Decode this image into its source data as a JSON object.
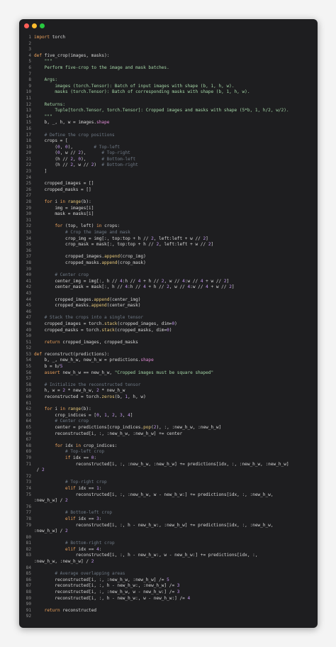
{
  "window": {
    "title_dots": [
      "close",
      "minimize",
      "zoom"
    ],
    "colors": {
      "background": "#1e1e20",
      "keyword": "#f0a45d",
      "string": "#a5d6a7",
      "comment": "#6f7a86",
      "number": "#c79bf2",
      "function": "#e8c97a",
      "attribute": "#e08bd6"
    }
  },
  "lines": [
    {
      "n": "1",
      "t": [
        [
          "kw",
          "import"
        ],
        [
          "p",
          " torch"
        ]
      ]
    },
    {
      "n": "2",
      "t": []
    },
    {
      "n": "3",
      "t": []
    },
    {
      "n": "4",
      "t": [
        [
          "kw",
          "def"
        ],
        [
          "p",
          " five_crop(images, masks):"
        ]
      ]
    },
    {
      "n": "5",
      "t": [
        [
          "str",
          "    \"\"\""
        ]
      ]
    },
    {
      "n": "6",
      "t": [
        [
          "str",
          "    Perform five-crop to the image and mask batches."
        ]
      ]
    },
    {
      "n": "7",
      "t": []
    },
    {
      "n": "8",
      "t": [
        [
          "str",
          "    Args:"
        ]
      ]
    },
    {
      "n": "9",
      "t": [
        [
          "str",
          "        images (torch.Tensor): Batch of input images with shape (b, 1, h, w)."
        ]
      ]
    },
    {
      "n": "10",
      "t": [
        [
          "str",
          "        masks (torch.Tensor): Batch of corresponding masks with shape (b, 1, h, w)."
        ]
      ]
    },
    {
      "n": "11",
      "t": []
    },
    {
      "n": "12",
      "t": [
        [
          "str",
          "    Returns:"
        ]
      ]
    },
    {
      "n": "13",
      "t": [
        [
          "str",
          "        Tuple[torch.Tensor, torch.Tensor]: Cropped images and masks with shape (5*b, 1, h/2, w/2)."
        ]
      ]
    },
    {
      "n": "14",
      "t": [
        [
          "str",
          "    \"\"\""
        ]
      ]
    },
    {
      "n": "15",
      "t": [
        [
          "p",
          "    b, _, h, w = images."
        ],
        [
          "attr",
          "shape"
        ]
      ]
    },
    {
      "n": "16",
      "t": []
    },
    {
      "n": "17",
      "t": [
        [
          "com",
          "    # Define the crop positions"
        ]
      ]
    },
    {
      "n": "18",
      "t": [
        [
          "p",
          "    crops = ["
        ]
      ]
    },
    {
      "n": "19",
      "t": [
        [
          "p",
          "        ("
        ],
        [
          "num",
          "0"
        ],
        [
          "p",
          ", "
        ],
        [
          "num",
          "0"
        ],
        [
          "p",
          "),        "
        ],
        [
          "com",
          "# Top-left"
        ]
      ]
    },
    {
      "n": "20",
      "t": [
        [
          "p",
          "        ("
        ],
        [
          "num",
          "0"
        ],
        [
          "p",
          ", w // "
        ],
        [
          "num",
          "2"
        ],
        [
          "p",
          "),      "
        ],
        [
          "com",
          "# Top-right"
        ]
      ]
    },
    {
      "n": "21",
      "t": [
        [
          "p",
          "        (h // "
        ],
        [
          "num",
          "2"
        ],
        [
          "p",
          ", "
        ],
        [
          "num",
          "0"
        ],
        [
          "p",
          "),      "
        ],
        [
          "com",
          "# Bottom-left"
        ]
      ]
    },
    {
      "n": "22",
      "t": [
        [
          "p",
          "        (h // "
        ],
        [
          "num",
          "2"
        ],
        [
          "p",
          ", w // "
        ],
        [
          "num",
          "2"
        ],
        [
          "p",
          ")  "
        ],
        [
          "com",
          "# Bottom-right"
        ]
      ]
    },
    {
      "n": "23",
      "t": [
        [
          "p",
          "    ]"
        ]
      ]
    },
    {
      "n": "24",
      "t": []
    },
    {
      "n": "25",
      "t": [
        [
          "p",
          "    cropped_images = []"
        ]
      ]
    },
    {
      "n": "26",
      "t": [
        [
          "p",
          "    cropped_masks = []"
        ]
      ]
    },
    {
      "n": "27",
      "t": []
    },
    {
      "n": "28",
      "t": [
        [
          "kw",
          "    for"
        ],
        [
          "p",
          " i "
        ],
        [
          "kw",
          "in"
        ],
        [
          "p",
          " "
        ],
        [
          "fn",
          "range"
        ],
        [
          "p",
          "(b):"
        ]
      ]
    },
    {
      "n": "29",
      "t": [
        [
          "p",
          "        img = images[i]"
        ]
      ]
    },
    {
      "n": "30",
      "t": [
        [
          "p",
          "        mask = masks[i]"
        ]
      ]
    },
    {
      "n": "31",
      "t": []
    },
    {
      "n": "32",
      "t": [
        [
          "kw",
          "        for"
        ],
        [
          "p",
          " (top, left) "
        ],
        [
          "kw",
          "in"
        ],
        [
          "p",
          " crops:"
        ]
      ]
    },
    {
      "n": "33",
      "t": [
        [
          "com",
          "            # Crop the image and mask"
        ]
      ]
    },
    {
      "n": "34",
      "t": [
        [
          "p",
          "            crop_img = img[:, top:top + h // "
        ],
        [
          "num",
          "2"
        ],
        [
          "p",
          ", left:left + w // "
        ],
        [
          "num",
          "2"
        ],
        [
          "p",
          "]"
        ]
      ]
    },
    {
      "n": "35",
      "t": [
        [
          "p",
          "            crop_mask = mask[:, top:top + h // "
        ],
        [
          "num",
          "2"
        ],
        [
          "p",
          ", left:left + w // "
        ],
        [
          "num",
          "2"
        ],
        [
          "p",
          "]"
        ]
      ]
    },
    {
      "n": "36",
      "t": []
    },
    {
      "n": "37",
      "t": [
        [
          "p",
          "            cropped_images."
        ],
        [
          "fn",
          "append"
        ],
        [
          "p",
          "(crop_img)"
        ]
      ]
    },
    {
      "n": "38",
      "t": [
        [
          "p",
          "            cropped_masks."
        ],
        [
          "fn",
          "append"
        ],
        [
          "p",
          "(crop_mask)"
        ]
      ]
    },
    {
      "n": "39",
      "t": []
    },
    {
      "n": "40",
      "t": [
        [
          "com",
          "        # Center crop"
        ]
      ]
    },
    {
      "n": "41",
      "t": [
        [
          "p",
          "        center_img = img[:, h // "
        ],
        [
          "num",
          "4"
        ],
        [
          "p",
          ":h // "
        ],
        [
          "num",
          "4"
        ],
        [
          "p",
          " + h // "
        ],
        [
          "num",
          "2"
        ],
        [
          "p",
          ", w // "
        ],
        [
          "num",
          "4"
        ],
        [
          "p",
          ":w // "
        ],
        [
          "num",
          "4"
        ],
        [
          "p",
          " + w // "
        ],
        [
          "num",
          "2"
        ],
        [
          "p",
          "]"
        ]
      ]
    },
    {
      "n": "42",
      "t": [
        [
          "p",
          "        center_mask = mask[:, h // "
        ],
        [
          "num",
          "4"
        ],
        [
          "p",
          ":h // "
        ],
        [
          "num",
          "4"
        ],
        [
          "p",
          " + h // "
        ],
        [
          "num",
          "2"
        ],
        [
          "p",
          ", w // "
        ],
        [
          "num",
          "4"
        ],
        [
          "p",
          ":w // "
        ],
        [
          "num",
          "4"
        ],
        [
          "p",
          " + w // "
        ],
        [
          "num",
          "2"
        ],
        [
          "p",
          "]"
        ]
      ]
    },
    {
      "n": "43",
      "t": []
    },
    {
      "n": "44",
      "t": [
        [
          "p",
          "        cropped_images."
        ],
        [
          "fn",
          "append"
        ],
        [
          "p",
          "(center_img)"
        ]
      ]
    },
    {
      "n": "45",
      "t": [
        [
          "p",
          "        cropped_masks."
        ],
        [
          "fn",
          "append"
        ],
        [
          "p",
          "(center_mask)"
        ]
      ]
    },
    {
      "n": "46",
      "t": []
    },
    {
      "n": "47",
      "t": [
        [
          "com",
          "    # Stack the crops into a single tensor"
        ]
      ]
    },
    {
      "n": "48",
      "t": [
        [
          "p",
          "    cropped_images = torch."
        ],
        [
          "fn",
          "stack"
        ],
        [
          "p",
          "(cropped_images, dim="
        ],
        [
          "num",
          "0"
        ],
        [
          "p",
          ")"
        ]
      ]
    },
    {
      "n": "49",
      "t": [
        [
          "p",
          "    cropped_masks = torch."
        ],
        [
          "fn",
          "stack"
        ],
        [
          "p",
          "(cropped_masks, dim="
        ],
        [
          "num",
          "0"
        ],
        [
          "p",
          ")"
        ]
      ]
    },
    {
      "n": "50",
      "t": []
    },
    {
      "n": "51",
      "t": [
        [
          "kw",
          "    return"
        ],
        [
          "p",
          " cropped_images, cropped_masks"
        ]
      ]
    },
    {
      "n": "52",
      "t": []
    },
    {
      "n": "53",
      "t": [
        [
          "kw",
          "def"
        ],
        [
          "p",
          " reconstruct(predictions):"
        ]
      ]
    },
    {
      "n": "54",
      "t": [
        [
          "p",
          "    b, _, new_h_w, new_h_w = predictions."
        ],
        [
          "attr",
          "shape"
        ]
      ]
    },
    {
      "n": "55",
      "t": [
        [
          "p",
          "    b = b/"
        ],
        [
          "num",
          "5"
        ]
      ]
    },
    {
      "n": "56",
      "t": [
        [
          "kw",
          "    assert"
        ],
        [
          "p",
          " new_h_w == new_h_w, "
        ],
        [
          "str",
          "\"Cropped images must be square shaped\""
        ]
      ]
    },
    {
      "n": "57",
      "t": []
    },
    {
      "n": "58",
      "t": [
        [
          "com",
          "    # Initialize the reconstructed tensor"
        ]
      ]
    },
    {
      "n": "59",
      "t": [
        [
          "p",
          "    h, w = "
        ],
        [
          "num",
          "2"
        ],
        [
          "p",
          " * new_h_w, "
        ],
        [
          "num",
          "2"
        ],
        [
          "p",
          " * new_h_w"
        ]
      ]
    },
    {
      "n": "60",
      "t": [
        [
          "p",
          "    reconstructed = torch."
        ],
        [
          "fn",
          "zeros"
        ],
        [
          "p",
          "(b, "
        ],
        [
          "num",
          "1"
        ],
        [
          "p",
          ", h, w)"
        ]
      ]
    },
    {
      "n": "61",
      "t": []
    },
    {
      "n": "62",
      "t": [
        [
          "kw",
          "    for"
        ],
        [
          "p",
          " i "
        ],
        [
          "kw",
          "in"
        ],
        [
          "p",
          " "
        ],
        [
          "fn",
          "range"
        ],
        [
          "p",
          "(b):"
        ]
      ]
    },
    {
      "n": "63",
      "t": [
        [
          "p",
          "        crop_indices = ["
        ],
        [
          "num",
          "0"
        ],
        [
          "p",
          ", "
        ],
        [
          "num",
          "1"
        ],
        [
          "p",
          ", "
        ],
        [
          "num",
          "2"
        ],
        [
          "p",
          ", "
        ],
        [
          "num",
          "3"
        ],
        [
          "p",
          ", "
        ],
        [
          "num",
          "4"
        ],
        [
          "p",
          "]"
        ]
      ]
    },
    {
      "n": "64",
      "t": [
        [
          "com",
          "        # Center crop"
        ]
      ]
    },
    {
      "n": "65",
      "t": [
        [
          "p",
          "        center = predictions[crop_indices."
        ],
        [
          "fn",
          "pop"
        ],
        [
          "p",
          "("
        ],
        [
          "num",
          "2"
        ],
        [
          "p",
          "), :, :new_h_w, :new_h_w]"
        ]
      ]
    },
    {
      "n": "66",
      "t": [
        [
          "p",
          "        reconstructed[i, :, :new_h_w, :new_h_w] += center"
        ]
      ]
    },
    {
      "n": "67",
      "t": []
    },
    {
      "n": "68",
      "t": [
        [
          "kw",
          "        for"
        ],
        [
          "p",
          " idx "
        ],
        [
          "kw",
          "in"
        ],
        [
          "p",
          " crop_indices:"
        ]
      ]
    },
    {
      "n": "69",
      "t": [
        [
          "com",
          "            # Top-left crop"
        ]
      ]
    },
    {
      "n": "70",
      "t": [
        [
          "kw",
          "            if"
        ],
        [
          "p",
          " idx == "
        ],
        [
          "num",
          "0"
        ],
        [
          "p",
          ":"
        ]
      ]
    },
    {
      "n": "71",
      "t": [
        [
          "p",
          "                reconstructed[i, :, :new_h_w, :new_h_w] += predictions[idx, :, :new_h_w, :new_h_w]"
        ]
      ]
    },
    {
      "n": "",
      "t": [
        [
          "p",
          " / "
        ],
        [
          "num",
          "2"
        ]
      ]
    },
    {
      "n": "72",
      "t": []
    },
    {
      "n": "73",
      "t": [
        [
          "com",
          "            # Top-right crop"
        ]
      ]
    },
    {
      "n": "74",
      "t": [
        [
          "kw",
          "            elif"
        ],
        [
          "p",
          " idx == "
        ],
        [
          "num",
          "1"
        ],
        [
          "p",
          ":"
        ]
      ]
    },
    {
      "n": "75",
      "t": [
        [
          "p",
          "                reconstructed[i, :, :new_h_w, w - new_h_w:] += predictions[idx, :, :new_h_w,"
        ]
      ]
    },
    {
      "n": "",
      "t": [
        [
          "p",
          ":new_h_w] / "
        ],
        [
          "num",
          "2"
        ]
      ]
    },
    {
      "n": "76",
      "t": []
    },
    {
      "n": "77",
      "t": [
        [
          "com",
          "            # Bottom-left crop"
        ]
      ]
    },
    {
      "n": "78",
      "t": [
        [
          "kw",
          "            elif"
        ],
        [
          "p",
          " idx == "
        ],
        [
          "num",
          "3"
        ],
        [
          "p",
          ":"
        ]
      ]
    },
    {
      "n": "79",
      "t": [
        [
          "p",
          "                reconstructed[i, :, h - new_h_w:, :new_h_w] += predictions[idx, :, :new_h_w,"
        ]
      ]
    },
    {
      "n": "",
      "t": [
        [
          "p",
          ":new_h_w] / "
        ],
        [
          "num",
          "2"
        ]
      ]
    },
    {
      "n": "80",
      "t": []
    },
    {
      "n": "81",
      "t": [
        [
          "com",
          "            # Bottom-right crop"
        ]
      ]
    },
    {
      "n": "82",
      "t": [
        [
          "kw",
          "            elif"
        ],
        [
          "p",
          " idx == "
        ],
        [
          "num",
          "4"
        ],
        [
          "p",
          ":"
        ]
      ]
    },
    {
      "n": "83",
      "t": [
        [
          "p",
          "                reconstructed[i, :, h - new_h_w:, w - new_h_w:] += predictions[idx, :,"
        ]
      ]
    },
    {
      "n": "",
      "t": [
        [
          "p",
          ":new_h_w, :new_h_w] / "
        ],
        [
          "num",
          "2"
        ]
      ]
    },
    {
      "n": "84",
      "t": []
    },
    {
      "n": "85",
      "t": [
        [
          "com",
          "        # Average overlapping areas"
        ]
      ]
    },
    {
      "n": "86",
      "t": [
        [
          "p",
          "        reconstructed[i, :, :new_h_w, :new_h_w] /= "
        ],
        [
          "num",
          "5"
        ]
      ]
    },
    {
      "n": "87",
      "t": [
        [
          "p",
          "        reconstructed[i, :, h - new_h_w:, :new_h_w] /= "
        ],
        [
          "num",
          "3"
        ]
      ]
    },
    {
      "n": "88",
      "t": [
        [
          "p",
          "        reconstructed[i, :, :new_h_w, w - new_h_w:] /= "
        ],
        [
          "num",
          "3"
        ]
      ]
    },
    {
      "n": "89",
      "t": [
        [
          "p",
          "        reconstructed[i, :, h - new_h_w:, w - new_h_w:] /= "
        ],
        [
          "num",
          "4"
        ]
      ]
    },
    {
      "n": "90",
      "t": []
    },
    {
      "n": "91",
      "t": [
        [
          "kw",
          "    return"
        ],
        [
          "p",
          " reconstructed"
        ]
      ]
    },
    {
      "n": "92",
      "t": []
    }
  ]
}
